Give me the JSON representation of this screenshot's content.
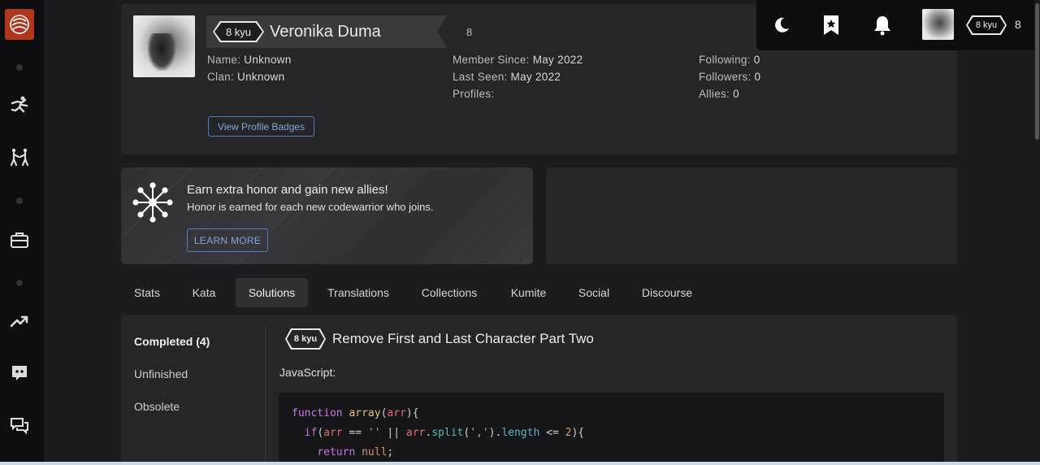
{
  "user": {
    "rank": "8 kyu",
    "name": "Veronika Duma",
    "honor": "8",
    "fields_left": [
      {
        "key": "Name:",
        "value": "Unknown"
      },
      {
        "key": "Clan:",
        "value": "Unknown"
      }
    ],
    "fields_mid": [
      {
        "key": "Member Since:",
        "value": "May 2022"
      },
      {
        "key": "Last Seen:",
        "value": "May 2022"
      },
      {
        "key": "Profiles:",
        "value": ""
      }
    ],
    "fields_right": [
      {
        "key": "Following:",
        "value": "0"
      },
      {
        "key": "Followers:",
        "value": "0"
      },
      {
        "key": "Allies:",
        "value": "0"
      }
    ],
    "badges_button": "View Profile Badges"
  },
  "topbar": {
    "rank": "8 kyu",
    "honor": "8",
    "icons": [
      "moon-icon",
      "bookmark-star-icon",
      "bell-icon"
    ]
  },
  "promo": {
    "title": "Earn extra honor and gain new allies!",
    "subtitle": "Honor is earned for each new codewarrior who joins.",
    "button": "LEARN MORE"
  },
  "tabs": [
    "Stats",
    "Kata",
    "Solutions",
    "Translations",
    "Collections",
    "Kumite",
    "Social",
    "Discourse"
  ],
  "active_tab": "Solutions",
  "solutions": {
    "filters": [
      "Completed (4)",
      "Unfinished",
      "Obsolete"
    ],
    "kata_rank": "8 kyu",
    "kata_title": "Remove First and Last Character Part Two",
    "language": "JavaScript:"
  },
  "colors": {
    "background": "#1c1c1e",
    "card": "#262629",
    "sidebar": "#0e0e10",
    "brand": "#b1361e",
    "link_blue": "#4d7fc4"
  }
}
